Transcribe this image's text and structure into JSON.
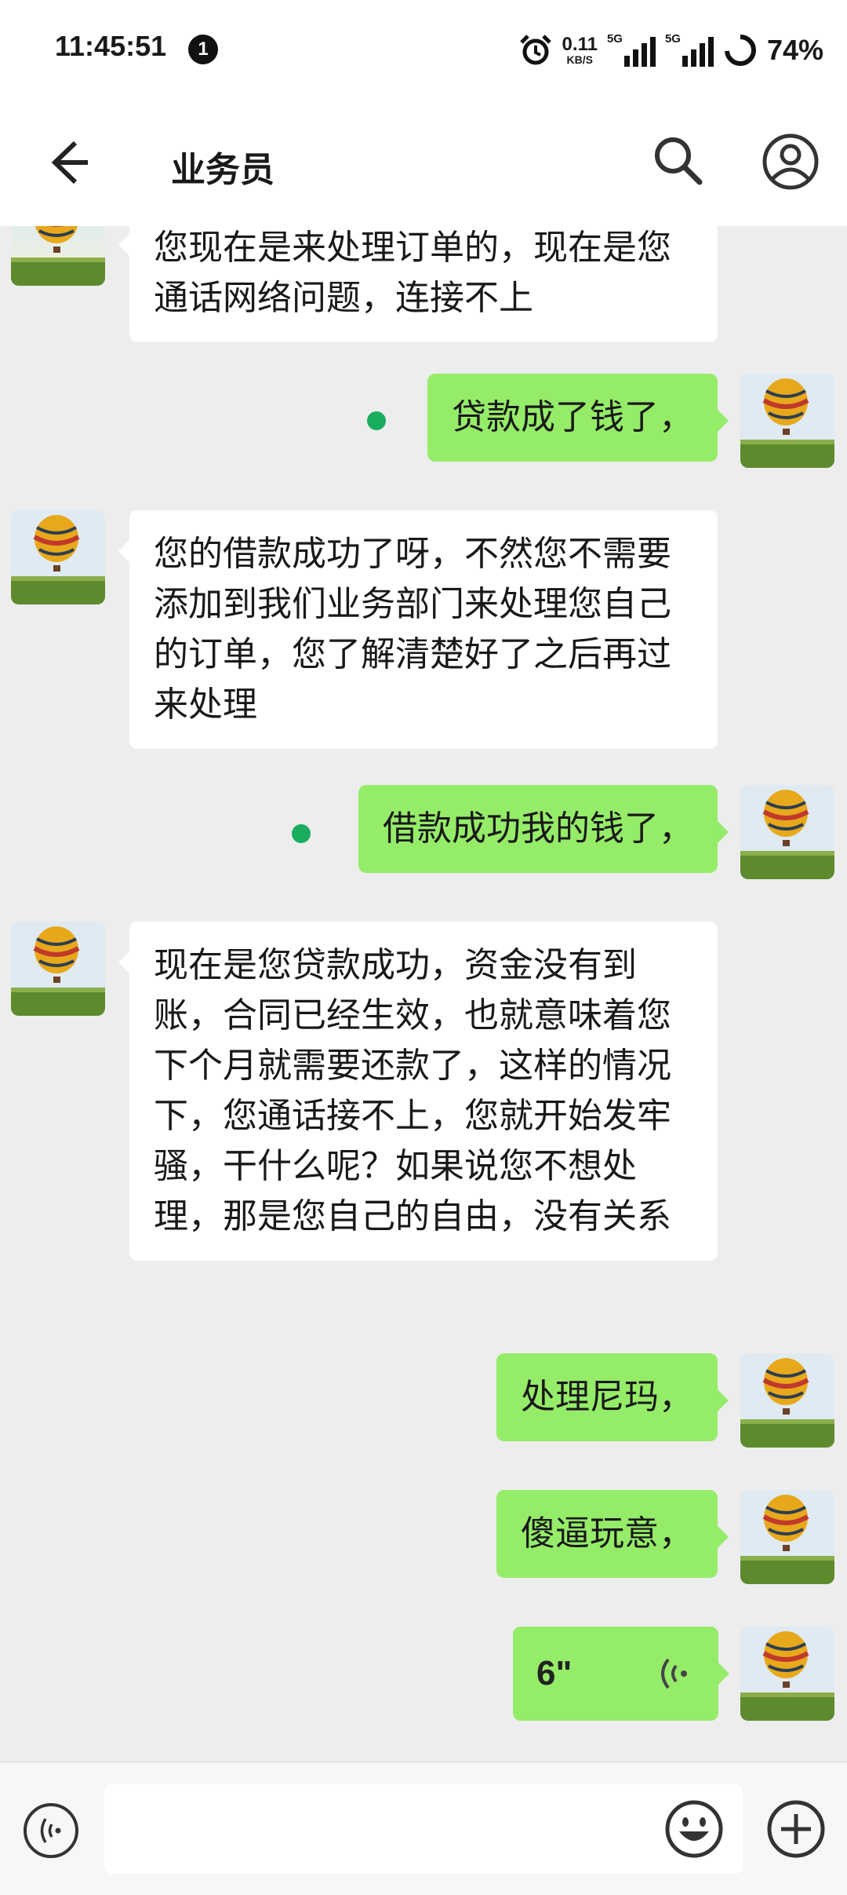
{
  "status_bar": {
    "time": "11:45:51",
    "notification_count": "1",
    "net_speed_value": "0.11",
    "net_speed_unit": "KB/S",
    "sim1_tag": "5G",
    "sim2_tag": "5G",
    "battery": "74%"
  },
  "header": {
    "title": "业务员"
  },
  "messages": [
    {
      "direction": "incoming",
      "text": "您现在是来处理订单的，现在是您通话网络问题，连接不上"
    },
    {
      "direction": "outgoing",
      "text": "贷款成了钱了，"
    },
    {
      "direction": "incoming",
      "text": "您的借款成功了呀，不然您不需要添加到我们业务部门来处理您自己的订单，您了解清楚好了之后再过来处理"
    },
    {
      "direction": "outgoing",
      "text": "借款成功我的钱了，"
    },
    {
      "direction": "incoming",
      "text": "现在是您贷款成功，资金没有到账，合同已经生效，也就意味着您下个月就需要还款了，这样的情况下，您通话接不上，您就开始发牢骚，干什么呢？如果说您不想处理，那是您自己的自由，没有关系"
    },
    {
      "direction": "outgoing",
      "text": "处理尼玛，"
    },
    {
      "direction": "outgoing",
      "text": "傻逼玩意，"
    },
    {
      "direction": "outgoing",
      "type": "voice",
      "duration": "6\""
    }
  ],
  "input": {
    "value": "",
    "placeholder": ""
  },
  "colors": {
    "outgoing_bubble": "#95ec69",
    "incoming_bubble": "#ffffff",
    "chat_background": "#ededed",
    "sent_dot": "#1aad5f"
  },
  "icons": {
    "back": "arrow-left-icon",
    "search": "search-icon",
    "profile": "person-circle-icon",
    "voice_toggle": "voice-mode-icon",
    "emoji": "emoji-icon",
    "plus": "plus-circle-icon",
    "avatar": "hot-air-balloon-avatar"
  }
}
